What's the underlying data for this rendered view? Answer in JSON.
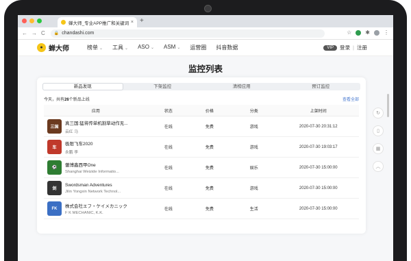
{
  "browser": {
    "tab_title": "蝉大师_专业APP推广和关键词优",
    "tab_close": "×",
    "new_tab": "+",
    "url": "chandashi.com",
    "nav_back": "←",
    "nav_forward": "→",
    "nav_reload": "C",
    "toolbar_icons": [
      "star-icon",
      "extension-icon",
      "puzzle-icon",
      "profile-icon",
      "menu-icon"
    ]
  },
  "site": {
    "logo_text": "蝉大师",
    "nav": [
      {
        "label": "榜单",
        "has_caret": true
      },
      {
        "label": "工具",
        "has_caret": true
      },
      {
        "label": "ASO",
        "has_caret": true
      },
      {
        "label": "ASM",
        "has_caret": true
      },
      {
        "label": "运营圈",
        "has_caret": false
      },
      {
        "label": "抖音数据",
        "has_caret": false
      }
    ],
    "vip": "VIP",
    "login": "登录",
    "divider": "|",
    "register": "注册"
  },
  "page": {
    "title": "监控列表",
    "tabs": [
      "新品发现",
      "下架监控",
      "清榜应用",
      "预订监控"
    ],
    "active_tab": 0,
    "summary_prefix": "今天，共有",
    "summary_count": "26",
    "summary_suffix": "个新品上线",
    "view_all": "查看全部",
    "columns": [
      "应用",
      "状态",
      "价格",
      "分类",
      "上架时间"
    ],
    "rows": [
      {
        "name": "真三国:猛将传单机割草动作无...",
        "developer": "云红 马",
        "status": "在线",
        "price": "免费",
        "category": "游戏",
        "time": "2020-07-30 20:31:12",
        "icon_color": "#6b3a1f",
        "icon_text": "三国"
      },
      {
        "name": "极限飞车2020",
        "developer": "永鹏 李",
        "status": "在线",
        "price": "免费",
        "category": "游戏",
        "time": "2020-07-30 19:03:17",
        "icon_color": "#c0392b",
        "icon_text": "车"
      },
      {
        "name": "蕾博鑫西甲One",
        "developer": "Shanghai Weizide Informatio...",
        "status": "在线",
        "price": "免费",
        "category": "娱乐",
        "time": "2020-07-30 15:00:00",
        "icon_color": "#2e7d32",
        "icon_text": "⚽"
      },
      {
        "name": "Swordsman Adventures",
        "developer": "Jilin Yongxin Network Technol...",
        "status": "在线",
        "price": "免费",
        "category": "游戏",
        "time": "2020-07-30 15:00:00",
        "icon_color": "#333333",
        "icon_text": "剑"
      },
      {
        "name": "株式会社エフ・ケイメカニック",
        "developer": "F K MECHANIC, K.K.",
        "status": "在线",
        "price": "免费",
        "category": "生活",
        "time": "2020-07-30 15:00:00",
        "icon_color": "#3b6fc4",
        "icon_text": "FK"
      }
    ]
  },
  "sidebar_icons": [
    "refresh-icon",
    "phone-icon",
    "grid-icon",
    "chevron-up-icon"
  ]
}
